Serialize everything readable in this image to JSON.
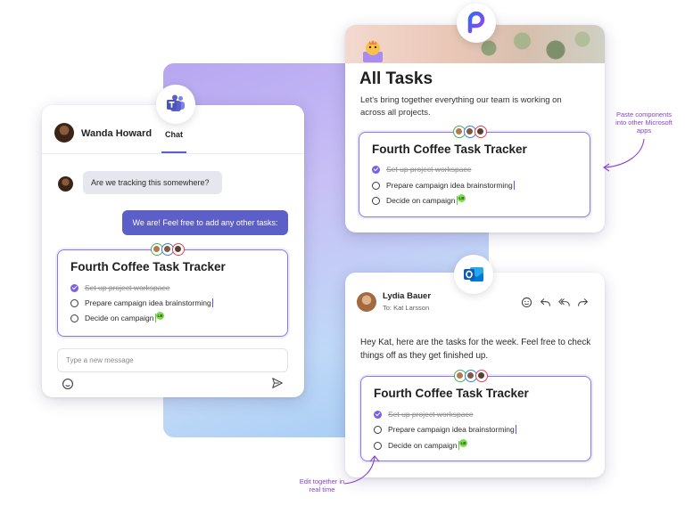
{
  "chat": {
    "contact_name": "Wanda Howard",
    "tab_label": "Chat",
    "incoming_message": "Are we tracking this somewhere?",
    "outgoing_message": "We are! Feel free to add any other tasks:",
    "input_placeholder": "Type a new message"
  },
  "tracker": {
    "title": "Fourth Coffee Task Tracker",
    "tasks": [
      {
        "label": "Set up project workspace",
        "done": true
      },
      {
        "label": "Prepare campaign idea brainstorming",
        "done": false
      },
      {
        "label": "Decide on campaign",
        "done": false
      }
    ],
    "collaborator_tag": "LB"
  },
  "loop": {
    "title": "All Tasks",
    "description": "Let's bring together everything our team is working on across all projects."
  },
  "mail": {
    "sender": "Lydia Bauer",
    "recipient": "To: Kat Larsson",
    "body": "Hey Kat, here are the tasks for the week. Feel free to check things off as they get finished up."
  },
  "annotations": {
    "paste": "Paste components into other Microsoft apps",
    "edit": "Edit together in real time"
  },
  "icons": {
    "teams": "teams-app-icon",
    "loop": "loop-app-icon",
    "outlook": "outlook-app-icon",
    "emoji": "emoji-icon",
    "send": "send-icon",
    "reply": "reply-icon",
    "reply_all": "reply-all-icon",
    "forward": "forward-icon"
  },
  "colors": {
    "teams_purple": "#5b5fc7",
    "loop_accent": "#8b78e6",
    "checked": "#7c5fe8",
    "annotation": "#8a3fd1"
  }
}
